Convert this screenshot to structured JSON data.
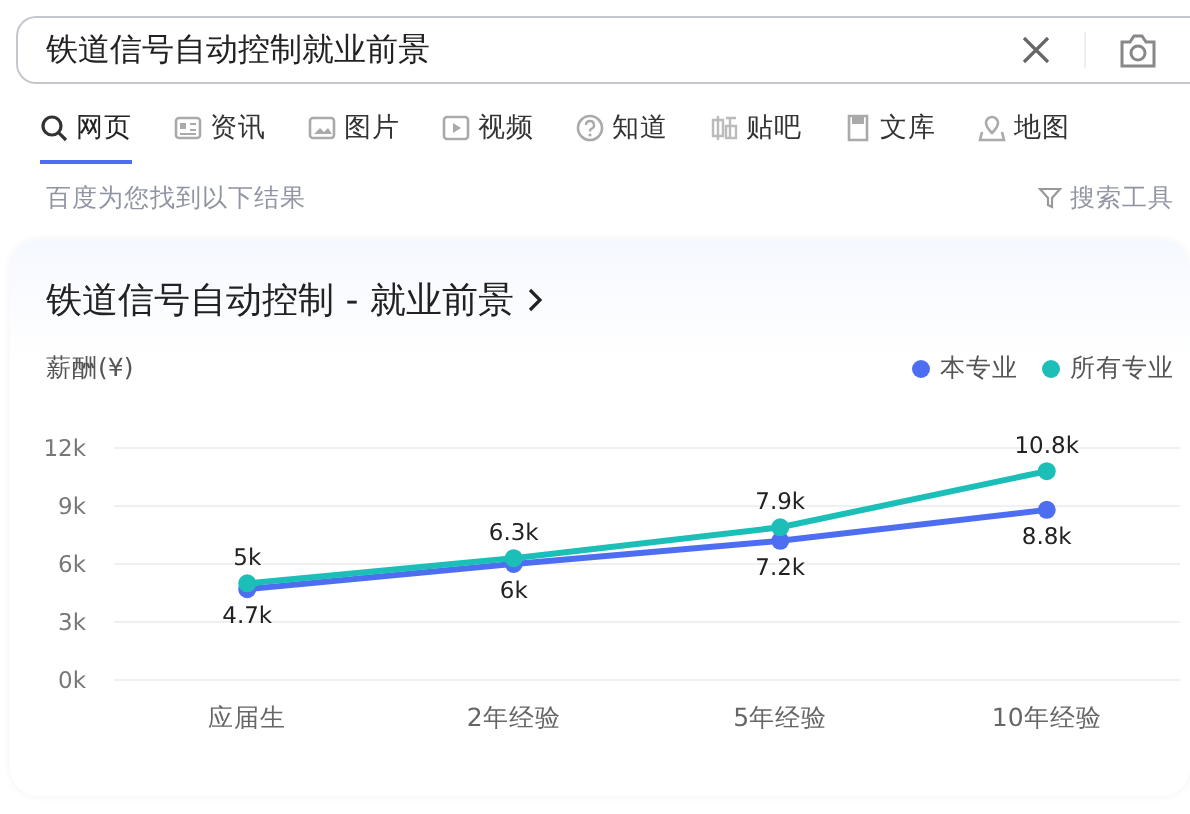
{
  "search": {
    "value": "铁道信号自动控制就业前景"
  },
  "tabs": [
    {
      "label": "网页",
      "selected": true
    },
    {
      "label": "资讯",
      "selected": false
    },
    {
      "label": "图片",
      "selected": false
    },
    {
      "label": "视频",
      "selected": false
    },
    {
      "label": "知道",
      "selected": false
    },
    {
      "label": "贴吧",
      "selected": false
    },
    {
      "label": "文库",
      "selected": false
    },
    {
      "label": "地图",
      "selected": false
    }
  ],
  "result_info": "百度为您找到以下结果",
  "search_tools": "搜索工具",
  "card": {
    "title": "铁道信号自动控制 - 就业前景",
    "unit_label": "薪酬(¥)",
    "chart_data": {
      "type": "line",
      "categories": [
        "应届生",
        "2年经验",
        "5年经验",
        "10年经验"
      ],
      "ylim": [
        0,
        12000
      ],
      "grid": true,
      "yticks": [
        {
          "value": 0,
          "label": "0k"
        },
        {
          "value": 3000,
          "label": "3k"
        },
        {
          "value": 6000,
          "label": "6k"
        },
        {
          "value": 9000,
          "label": "9k"
        },
        {
          "value": 12000,
          "label": "12k"
        }
      ],
      "series": [
        {
          "name": "本专业",
          "color": "#4e6ef2",
          "marker": "circle",
          "values": [
            4700,
            6000,
            7200,
            8800
          ],
          "value_labels": [
            "4.7k",
            "6k",
            "7.2k",
            "8.8k"
          ]
        },
        {
          "name": "所有专业",
          "color": "#1cbfb7",
          "marker": "circle",
          "values": [
            5000,
            6300,
            7900,
            10800
          ],
          "value_labels": [
            "5k",
            "6.3k",
            "7.9k",
            "10.8k"
          ]
        }
      ]
    }
  }
}
